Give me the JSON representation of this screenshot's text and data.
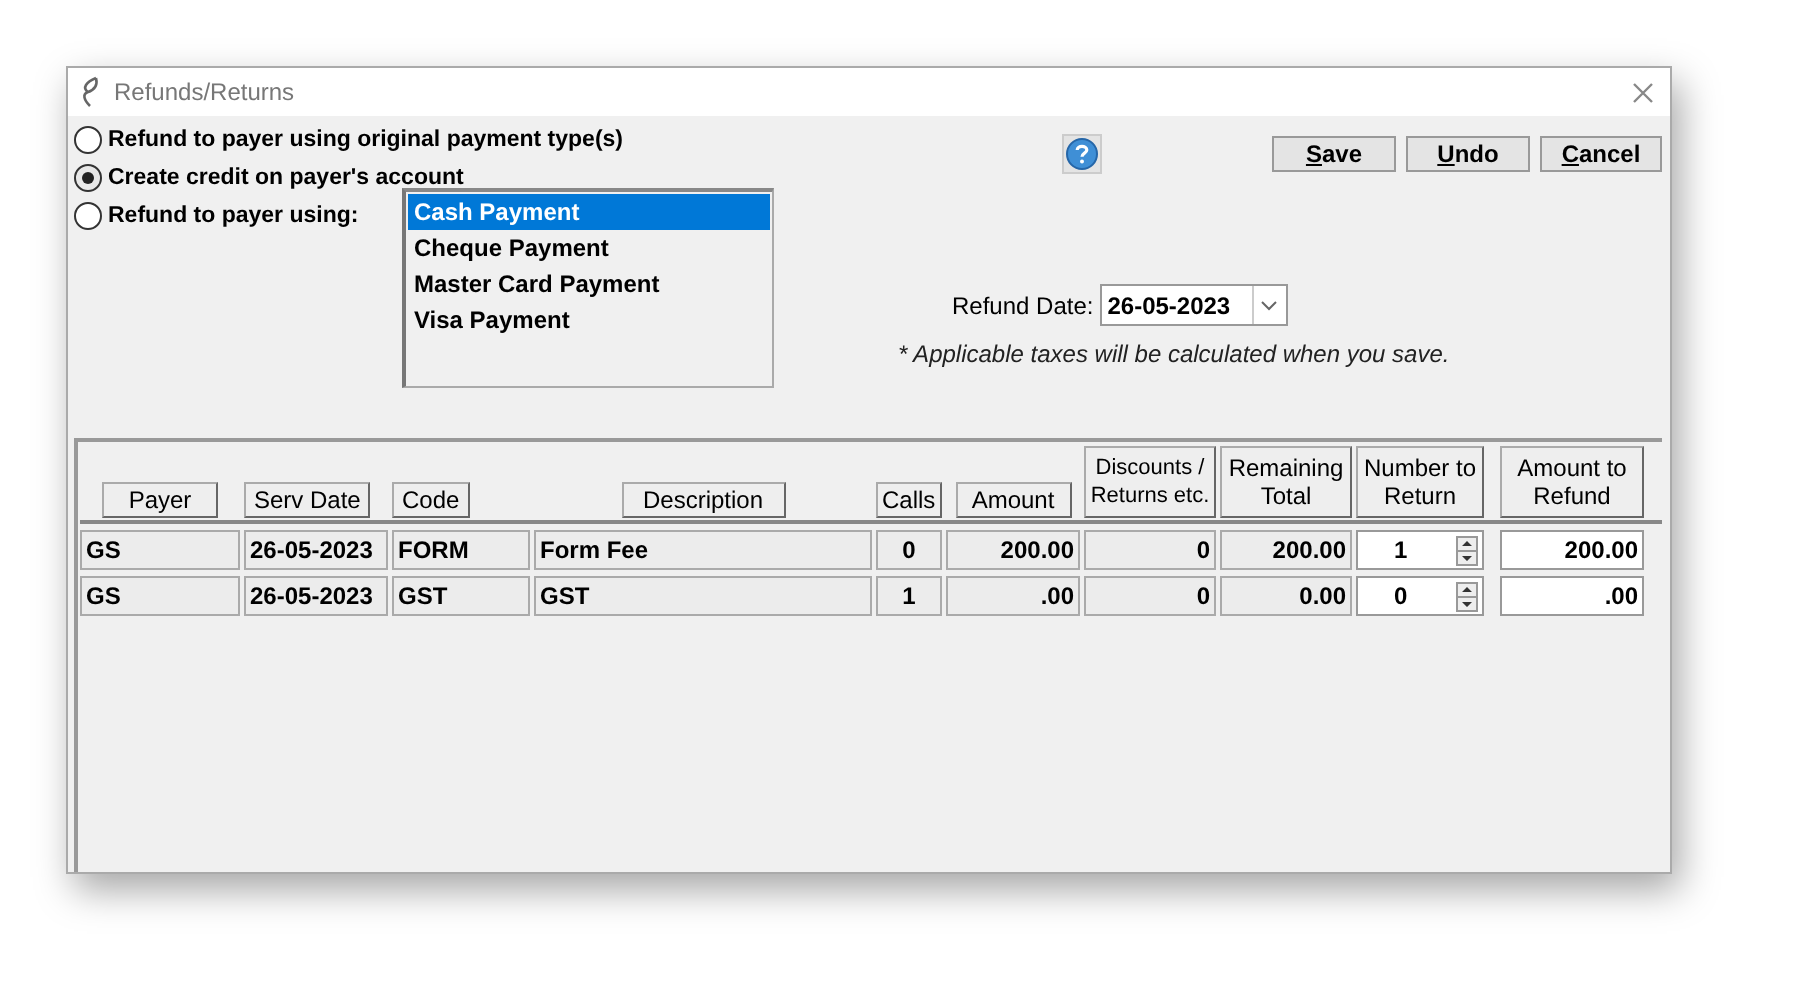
{
  "window": {
    "title": "Refunds/Returns"
  },
  "options": [
    {
      "label": "Refund to payer using original payment type(s)",
      "selected": false
    },
    {
      "label": "Create credit on payer's account",
      "selected": true
    },
    {
      "label": "Refund to payer using:",
      "selected": false
    }
  ],
  "payment_methods": [
    {
      "label": "Cash Payment",
      "selected": true
    },
    {
      "label": "Cheque Payment",
      "selected": false
    },
    {
      "label": "Master Card Payment",
      "selected": false
    },
    {
      "label": "Visa Payment",
      "selected": false
    }
  ],
  "buttons": [
    {
      "mnemonic": "S",
      "rest": "ave"
    },
    {
      "mnemonic": "U",
      "rest": "ndo"
    },
    {
      "mnemonic": "C",
      "rest": "ancel"
    }
  ],
  "refund_date": {
    "label": "Refund Date:",
    "value": "26-05-2023"
  },
  "note": "* Applicable taxes will be calculated when you save.",
  "table": {
    "columns": [
      "Payer",
      "Serv Date",
      "Code",
      "Description",
      "Calls",
      "Amount",
      "Discounts / Returns etc.",
      "Remaining Total",
      "Number to Return",
      "Amount to Refund"
    ],
    "rows": [
      {
        "payer": "GS",
        "serv_date": "26-05-2023",
        "code": "FORM",
        "description": "Form Fee",
        "calls": "0",
        "amount": "200.00",
        "discounts": "0",
        "remaining_total": "200.00",
        "number_to_return": "1",
        "amount_to_refund": "200.00"
      },
      {
        "payer": "GS",
        "serv_date": "26-05-2023",
        "code": "GST",
        "description": "GST",
        "calls": "1",
        "amount": ".00",
        "discounts": "0",
        "remaining_total": "0.00",
        "number_to_return": "0",
        "amount_to_refund": ".00"
      }
    ]
  }
}
